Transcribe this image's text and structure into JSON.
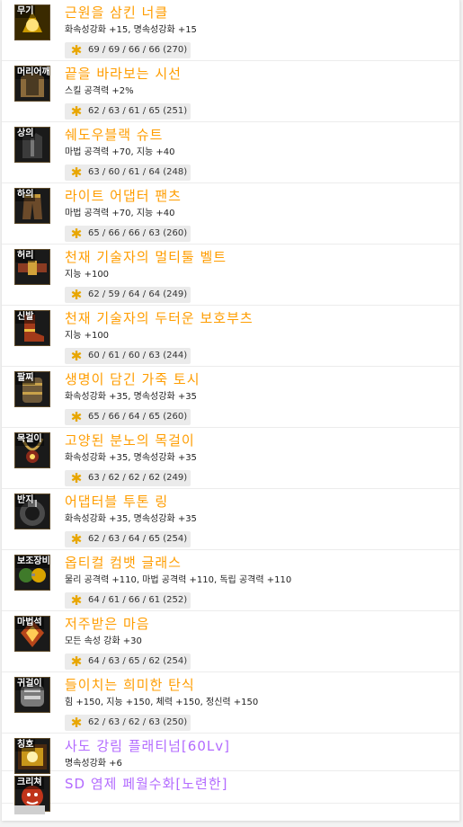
{
  "items": [
    {
      "slot": "무기",
      "name": "근원을 삼킨 너클",
      "stat": "화속성강화 +15, 명속성강화 +15",
      "stars": "69 / 69 / 66 / 66 (270)",
      "name_color": "#ff9d00",
      "icon": "knuckle-icon",
      "icon_color": "#d9a400"
    },
    {
      "slot": "머리어깨",
      "name": "끝을 바라보는 시선",
      "stat": "스킬 공격력 +2%",
      "stars": "62 / 63 / 61 / 65 (251)",
      "name_color": "#ff9d00",
      "icon": "shoulder-armor-icon",
      "icon_color": "#8a6a3b"
    },
    {
      "slot": "상의",
      "name": "쉐도우블랙 슈트",
      "stat": "마법 공격력 +70, 지능 +40",
      "stars": "63 / 60 / 61 / 64 (248)",
      "name_color": "#ff9d00",
      "icon": "suit-top-icon",
      "icon_color": "#3b3b3b"
    },
    {
      "slot": "하의",
      "name": "라이트 어댑터 팬츠",
      "stat": "마법 공격력 +70, 지능 +40",
      "stars": "65 / 66 / 66 / 63 (260)",
      "name_color": "#ff9d00",
      "icon": "pants-icon",
      "icon_color": "#6b4a2a"
    },
    {
      "slot": "허리",
      "name": "천재 기술자의 멀티툴 벨트",
      "stat": "지능 +100",
      "stars": "62 / 59 / 64 / 64 (249)",
      "name_color": "#ff9d00",
      "icon": "belt-icon",
      "icon_color": "#8b3b22"
    },
    {
      "slot": "신발",
      "name": "천재 기술자의 두터운 보호부츠",
      "stat": "지능 +100",
      "stars": "60 / 61 / 60 / 63 (244)",
      "name_color": "#ff9d00",
      "icon": "boots-icon",
      "icon_color": "#a33a1a"
    },
    {
      "slot": "팔찌",
      "name": "생명이 담긴 가죽 토시",
      "stat": "화속성강화 +35, 명속성강화 +35",
      "stars": "65 / 66 / 64 / 65 (260)",
      "name_color": "#ff9d00",
      "icon": "bracelet-icon",
      "icon_color": "#6f5a3a"
    },
    {
      "slot": "목걸이",
      "name": "고양된 분노의 목걸이",
      "stat": "화속성강화 +35, 명속성강화 +35",
      "stars": "63 / 62 / 62 / 62 (249)",
      "name_color": "#ff9d00",
      "icon": "necklace-icon",
      "icon_color": "#8b2a1a"
    },
    {
      "slot": "반지",
      "name": "어댑터블 투톤 링",
      "stat": "화속성강화 +35, 명속성강화 +35",
      "stars": "62 / 63 / 64 / 65 (254)",
      "name_color": "#ff9d00",
      "icon": "ring-icon",
      "icon_color": "#4a4a4a"
    },
    {
      "slot": "보조장비",
      "name": "옵티컬 컴뱃 글래스",
      "stat": "물리 공격력 +110, 마법 공격력 +110, 독립 공격력 +110",
      "stars": "64 / 61 / 66 / 61 (252)",
      "name_color": "#ff9d00",
      "icon": "glasses-icon",
      "icon_color": "#3f7a2a"
    },
    {
      "slot": "마법석",
      "name": "저주받은 마음",
      "stat": "모든 속성 강화 +30",
      "stars": "64 / 63 / 65 / 62 (254)",
      "name_color": "#ff9d00",
      "icon": "magic-stone-icon",
      "icon_color": "#b8461a"
    },
    {
      "slot": "귀걸이",
      "name": "들이치는 희미한 탄식",
      "stat": "힘 +150, 지능 +150, 체력 +150, 정신력 +150",
      "stars": "62 / 63 / 62 / 63 (250)",
      "name_color": "#ff9d00",
      "icon": "earring-icon",
      "icon_color": "#7a7a7a"
    },
    {
      "slot": "칭호",
      "name": "사도 강림 플래티넘[60Lv]",
      "stat": "명속성강화 +6",
      "stars": "",
      "name_color": "#b36bff",
      "icon": "title-badge-icon",
      "icon_color": "#c8961a"
    },
    {
      "slot": "크리쳐",
      "name": "SD 염제 페월수화[노련한]",
      "stat": "",
      "stars": "",
      "name_color": "#b36bff",
      "icon": "creature-icon",
      "icon_color": "#c0341a"
    }
  ],
  "colors": {
    "legendary": "#ff9d00",
    "epic_purple": "#b36bff",
    "star": "#e8a600",
    "bar_bg": "#ebebeb"
  }
}
